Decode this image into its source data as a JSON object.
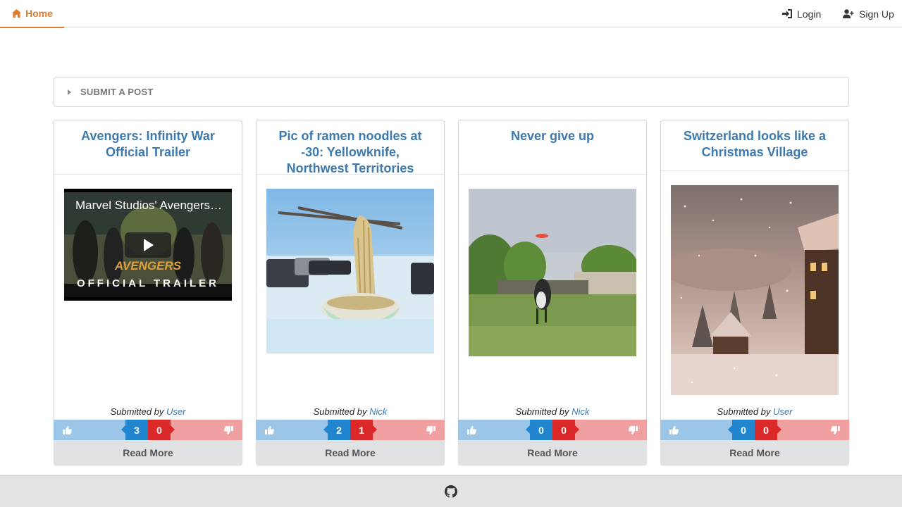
{
  "nav": {
    "home": "Home",
    "login": "Login",
    "signup": "Sign Up"
  },
  "submit": {
    "label": "SUBMIT A POST"
  },
  "posts": [
    {
      "title": "Avengers: Infinity War Official Trailer",
      "video_title": "Marvel Studios' Avengers: Infinity War Official Trailer",
      "video_logo": "AVENGERS",
      "video_caption": "OFFICIAL TRAILER",
      "submitted_prefix": "Submitted by",
      "author": "User",
      "up": "3",
      "down": "0",
      "read_more": "Read More"
    },
    {
      "title": "Pic of ramen noodles at -30: Yellowknife, Northwest Territories",
      "submitted_prefix": "Submitted by",
      "author": "Nick",
      "up": "2",
      "down": "1",
      "read_more": "Read More"
    },
    {
      "title": "Never give up",
      "submitted_prefix": "Submitted by",
      "author": "Nick",
      "up": "0",
      "down": "0",
      "read_more": "Read More"
    },
    {
      "title": "Switzerland looks like a Christmas Village",
      "submitted_prefix": "Submitted by",
      "author": "User",
      "up": "0",
      "down": "0",
      "read_more": "Read More"
    }
  ],
  "colors": {
    "accent": "#e07a2e",
    "link": "#3d79ad",
    "upvote": "#2185d0",
    "downvote": "#db2828"
  },
  "icons": [
    "home-icon",
    "sign-in-icon",
    "add-user-icon",
    "caret-right-icon",
    "thumbs-up-icon",
    "thumbs-down-icon",
    "github-icon",
    "play-icon"
  ]
}
